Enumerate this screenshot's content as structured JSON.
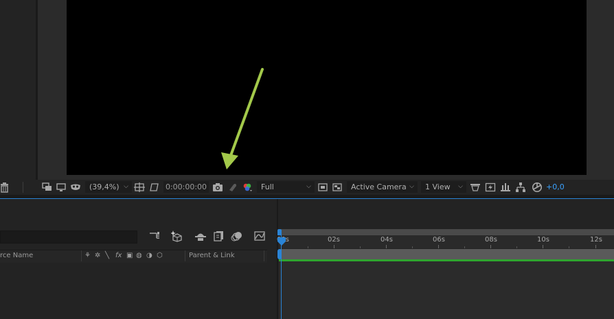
{
  "viewer": {
    "zoom": "(39,4%)",
    "timecode": "0:00:00:00",
    "resolution": "Full",
    "camera": "Active Camera",
    "views": "1 View",
    "exposure": "+0,0"
  },
  "timeline": {
    "columns": {
      "source_name": "rce Name",
      "switches": [
        "⚘",
        "✲",
        "╲",
        "fx",
        "▣",
        "◍",
        "◑",
        "⬡"
      ],
      "parent_link": "Parent & Link"
    },
    "ruler_labels": [
      "00s",
      "02s",
      "04s",
      "06s",
      "08s",
      "10s",
      "12s"
    ]
  },
  "colors": {
    "accent_blue": "#2a84d6",
    "exposure_blue": "#3aa2ff",
    "track_green": "#2fa42f",
    "annotation_green": "#a3c94a"
  },
  "icons": {
    "viewer_toolbar": [
      "always-preview-icon",
      "monitor-icon",
      "mask-visibility-icon",
      "grid-guides-icon",
      "transparency-grid-icon",
      "snapshot-icon",
      "show-snapshot-icon",
      "channel-icon",
      "region-of-interest-icon",
      "toggle-transparency-icon",
      "draft-3d-icon",
      "fast-previews-icon",
      "timeline-icon",
      "flowchart-icon",
      "reset-exposure-icon"
    ],
    "timeline_toolbar": [
      "comp-flowchart-icon",
      "draft-3d-toggle-icon",
      "shy-layers-icon",
      "frame-blending-icon",
      "motion-blur-icon",
      "graph-editor-icon"
    ]
  }
}
